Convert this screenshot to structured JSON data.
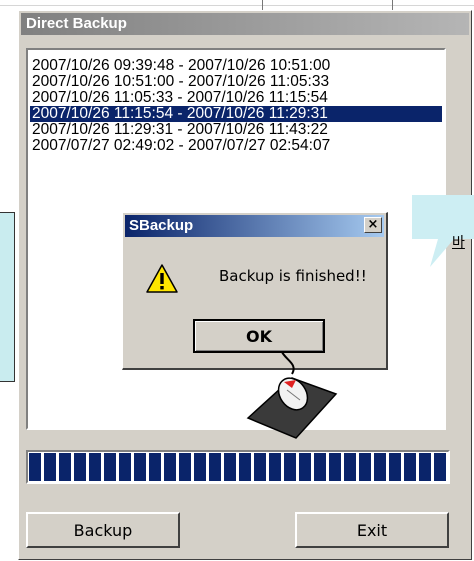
{
  "window": {
    "title": "Direct Backup"
  },
  "backup_list": {
    "items": [
      "2007/10/26 09:39:48 - 2007/10/26 10:51:00",
      "2007/10/26 10:51:00 - 2007/10/26 11:05:33",
      "2007/10/26 11:05:33 - 2007/10/26 11:15:54",
      "2007/10/26 11:15:54 - 2007/10/26 11:29:31",
      "2007/10/26 11:29:31 - 2007/10/26 11:43:22",
      "2007/07/27 02:49:02 - 2007/07/27 02:54:07"
    ],
    "selected_index": 3
  },
  "progress": {
    "fraction": 1.0
  },
  "buttons": {
    "backup_label": "Backup",
    "exit_label": "Exit"
  },
  "dialog": {
    "title": "SBackup",
    "message": "Backup is finished!!",
    "ok_label": "OK",
    "close_glyph": "×",
    "icon": "warning-icon"
  },
  "annotation": {
    "bubble_text": "바"
  },
  "colors": {
    "selection": "#0a246a",
    "progress_block": "#0a246a",
    "window_face": "#d4d0c8",
    "left_note_fill": "#c9ecef",
    "bubble_fill": "#cdeef3"
  }
}
